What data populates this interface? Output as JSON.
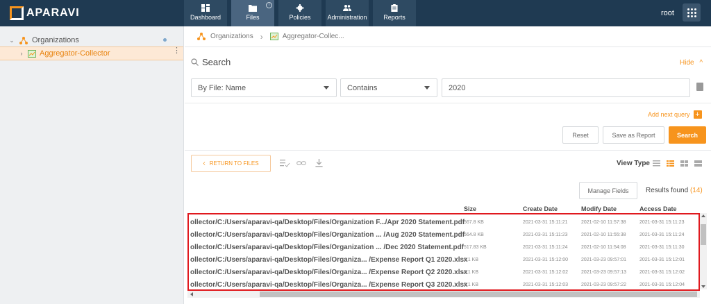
{
  "app": {
    "logo": "APARAVI",
    "user": "root"
  },
  "nav": [
    {
      "label": "Dashboard",
      "icon": "dashboard-icon"
    },
    {
      "label": "Files",
      "icon": "folder-icon"
    },
    {
      "label": "Policies",
      "icon": "gear-icon"
    },
    {
      "label": "Administration",
      "icon": "users-icon"
    },
    {
      "label": "Reports",
      "icon": "clipboard-icon"
    }
  ],
  "sidebar": {
    "items": [
      {
        "label": "Organizations"
      },
      {
        "label": "Aggregator-Collector"
      }
    ]
  },
  "breadcrumb": {
    "root": "Organizations",
    "current": "Aggregator-Collec..."
  },
  "search": {
    "title": "Search",
    "hide_label": "Hide",
    "field": "By File: Name",
    "operator": "Contains",
    "value": "2020",
    "add_query": "Add next query",
    "reset": "Reset",
    "save_report": "Save as Report",
    "search_button": "Search"
  },
  "results": {
    "return_label": "RETURN TO FILES",
    "view_type_label": "View Type",
    "manage_fields": "Manage Fields",
    "found_label": "Results found",
    "found_count": "(14)",
    "columns": {
      "size": "Size",
      "create": "Create Date",
      "modify": "Modify Date",
      "access": "Access Date"
    },
    "rows": [
      {
        "name": "ollector/C:/Users/aparavi-qa/Desktop/Files/Organization F.../Apr 2020 Statement.pdf",
        "size": "567.8 KB",
        "create": "2021-03-31 15:11:21",
        "modify": "2021-02-10 11:57:38",
        "access": "2021-03-31 15:11:23"
      },
      {
        "name": "ollector/C:/Users/aparavi-qa/Desktop/Files/Organization ... /Aug 2020 Statement.pdf",
        "size": "564.8 KB",
        "create": "2021-03-31 15:11:23",
        "modify": "2021-02-10 11:55:38",
        "access": "2021-03-31 15:11:24"
      },
      {
        "name": "ollector/C:/Users/aparavi-qa/Desktop/Files/Organization ... /Dec 2020 Statement.pdf",
        "size": "517.83 KB",
        "create": "2021-03-31 15:11:24",
        "modify": "2021-02-10 11:54:08",
        "access": "2021-03-31 15:11:30"
      },
      {
        "name": "ollector/C:/Users/aparavi-qa/Desktop/Files/Organiza... /Expense Report Q1 2020.xlsx",
        "size": "8.1 KB",
        "create": "2021-03-31 15:12:00",
        "modify": "2021-03-23 09:57:01",
        "access": "2021-03-31 15:12:01"
      },
      {
        "name": "ollector/C:/Users/aparavi-qa/Desktop/Files/Organiza... /Expense Report Q2 2020.xlsx",
        "size": "8.1 KB",
        "create": "2021-03-31 15:12:02",
        "modify": "2021-03-23 09:57:13",
        "access": "2021-03-31 15:12:02"
      },
      {
        "name": "ollector/C:/Users/aparavi-qa/Desktop/Files/Organiza... /Expense Report Q3 2020.xlsx",
        "size": "8.1 KB",
        "create": "2021-03-31 15:12:03",
        "modify": "2021-03-23 09:57:22",
        "access": "2021-03-31 15:12:04"
      }
    ]
  },
  "colors": {
    "accent": "#f7941d",
    "topbar": "#1f3a52",
    "highlight": "#e0191e"
  }
}
